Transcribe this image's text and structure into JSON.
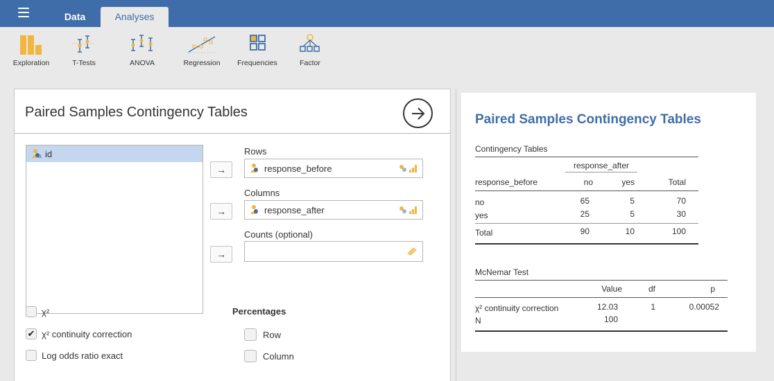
{
  "topbar": {
    "menu_icon": "hamburger-menu-icon",
    "tabs": [
      {
        "label": "Data",
        "active": false
      },
      {
        "label": "Analyses",
        "active": true
      }
    ],
    "brand_color": "#3e6da9"
  },
  "ribbon": {
    "items": [
      {
        "label": "Exploration",
        "icon": "bar-chart-icon"
      },
      {
        "label": "T-Tests",
        "icon": "t-test-icon"
      },
      {
        "label": "ANOVA",
        "icon": "anova-icon"
      },
      {
        "label": "Regression",
        "icon": "regression-icon"
      },
      {
        "label": "Frequencies",
        "icon": "frequencies-icon"
      },
      {
        "label": "Factor",
        "icon": "factor-icon"
      }
    ]
  },
  "options": {
    "title": "Paired Samples Contingency Tables",
    "variables": [
      "id"
    ],
    "rows_label": "Rows",
    "rows_value": "response_before",
    "columns_label": "Columns",
    "columns_value": "response_after",
    "counts_label": "Counts (optional)",
    "counts_value": "",
    "arrow_glyph": "→",
    "checks": [
      {
        "label": "χ²",
        "checked": false
      },
      {
        "label": "χ² continuity correction",
        "checked": true
      },
      {
        "label": "Log odds ratio exact",
        "checked": false
      }
    ],
    "percentages_label": "Percentages",
    "percentages": [
      {
        "label": "Row",
        "checked": false
      },
      {
        "label": "Column",
        "checked": false
      }
    ],
    "check_glyph": "✔"
  },
  "results": {
    "title": "Paired Samples Contingency Tables",
    "contingency": {
      "title": "Contingency Tables",
      "spanner": "response_after",
      "row_header": "response_before",
      "col_headers": [
        "no",
        "yes",
        "Total"
      ],
      "rows": [
        {
          "label": "no",
          "values": [
            "65",
            "5",
            "70"
          ]
        },
        {
          "label": "yes",
          "values": [
            "25",
            "5",
            "30"
          ]
        }
      ],
      "total_row": {
        "label": "Total",
        "values": [
          "90",
          "10",
          "100"
        ]
      }
    },
    "mcnemar": {
      "title": "McNemar Test",
      "col_headers": [
        "Value",
        "df",
        "p"
      ],
      "rows": [
        {
          "label": "χ² continuity correction",
          "value": "12.03",
          "df": "1",
          "p": "0.00052"
        },
        {
          "label": "N",
          "value": "100",
          "df": "",
          "p": ""
        }
      ]
    }
  }
}
